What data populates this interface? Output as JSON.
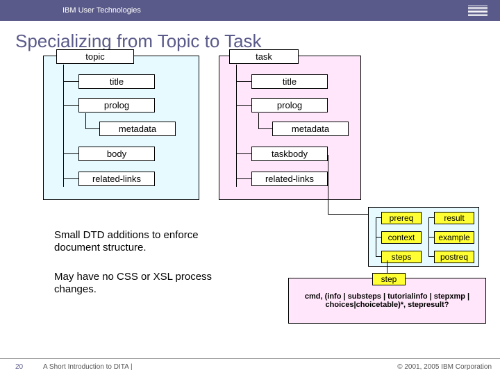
{
  "header": {
    "org": "IBM User Technologies",
    "logo_text": "IBM"
  },
  "title": "Specializing from Topic to Task",
  "trees": {
    "topic": {
      "root": "topic",
      "children": [
        "title",
        "prolog",
        "metadata",
        "body",
        "related-links"
      ]
    },
    "task": {
      "root": "task",
      "children": [
        "title",
        "prolog",
        "metadata",
        "taskbody",
        "related-links"
      ]
    }
  },
  "notes": [
    "Small DTD additions to enforce document structure.",
    "May have no CSS or XSL process changes."
  ],
  "detail_blue": {
    "cols": [
      [
        "prereq",
        "context",
        "steps"
      ],
      [
        "result",
        "example",
        "postreq"
      ]
    ]
  },
  "detail_pink": {
    "root": "step",
    "rule": "cmd, (info | substeps | tutorialinfo | stepxmp | choices|choicetable)*, stepresult?"
  },
  "footer": {
    "page": "20",
    "doc": "A Short Introduction to DITA |",
    "copyright": "© 2001, 2005 IBM Corporation"
  }
}
